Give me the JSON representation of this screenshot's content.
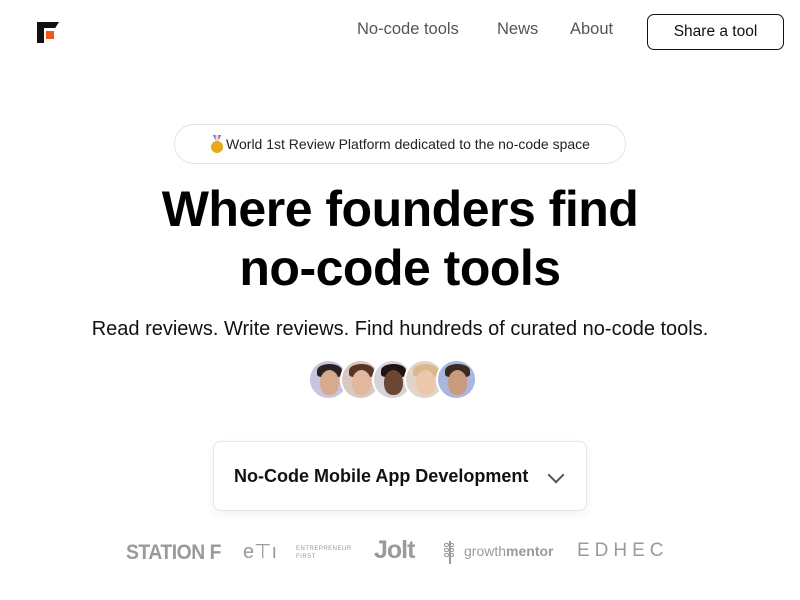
{
  "header": {
    "logo_name": "site-logo",
    "nav": [
      {
        "label": "No-code tools"
      },
      {
        "label": "News"
      },
      {
        "label": "About"
      }
    ],
    "cta_label": "Share a tool"
  },
  "hero": {
    "badge_icon": "1st-place-medal-icon",
    "badge_text": "World 1st Review Platform dedicated to the no-code space",
    "headline_line1": "Where founders find",
    "headline_line2": "no-code tools",
    "subtitle": "Read reviews. Write reviews. Find hundreds of curated no-code tools."
  },
  "avatars": [
    {
      "name": "avatar-1",
      "bg": "#c9c3e0",
      "skin": "#d7a98d",
      "hair": "#2a2220"
    },
    {
      "name": "avatar-2",
      "bg": "#d9c8bf",
      "skin": "#e2b79e",
      "hair": "#5a3422"
    },
    {
      "name": "avatar-3",
      "bg": "#d6d2d8",
      "skin": "#6b4634",
      "hair": "#1e1512"
    },
    {
      "name": "avatar-4",
      "bg": "#e2d4c8",
      "skin": "#edc7ad",
      "hair": "#d8b98a"
    },
    {
      "name": "avatar-5",
      "bg": "#a9b6dd",
      "skin": "#c99a7c",
      "hair": "#3b2a20"
    }
  ],
  "category_dropdown": {
    "selected": "No-Code Mobile App Development"
  },
  "partners": {
    "station_f": "STATION F",
    "entrepreneur_first_mark": "e⊤ı",
    "entrepreneur_first_line1": "ENTREPRENEUR",
    "entrepreneur_first_line2": "FIRST",
    "jolt": "Jolt",
    "growthmentor_light": "growth",
    "growthmentor_bold": "mentor",
    "edhec": "EDHEC"
  },
  "colors": {
    "brand_orange": "#f05a1a",
    "text_primary": "#111111",
    "nav_text": "#555555",
    "partner_gray": "#9a9a9a"
  }
}
